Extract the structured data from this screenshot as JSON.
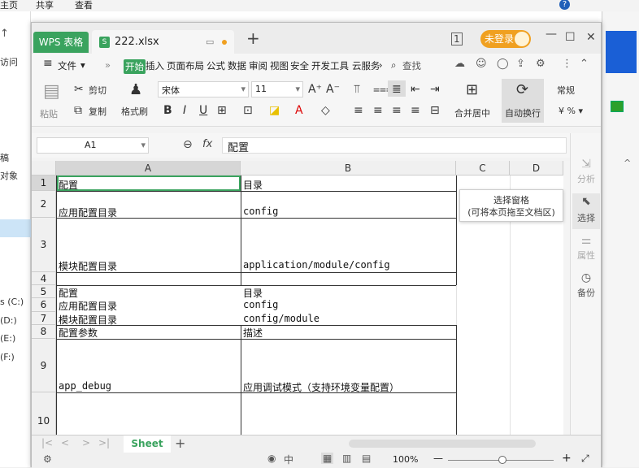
{
  "explorer": {
    "menu": [
      "主页",
      "共享",
      "查看"
    ],
    "sidebar": [
      "访问",
      "",
      "",
      "",
      "稿",
      "对象",
      "",
      "",
      "",
      "",
      "s (C:)",
      "(D:)",
      "(E:)",
      "(F:)"
    ]
  },
  "window": {
    "app_tab": "WPS 表格",
    "file_tab": "222.xlsx",
    "login": "未登录"
  },
  "menu": {
    "file": "文件",
    "tabs": [
      "开始",
      "插入",
      "页面布局",
      "公式",
      "数据",
      "审阅",
      "视图",
      "安全",
      "开发工具",
      "云服务"
    ],
    "search": "查找"
  },
  "ribbon": {
    "paste": "粘贴",
    "cut": "剪切",
    "copy": "复制",
    "format_painter": "格式刷",
    "font": "宋体",
    "size": "11",
    "merge": "合并居中",
    "wrap": "自动换行",
    "numfmt": "常规",
    "percent": "¥ % ▾"
  },
  "formula": {
    "cellref": "A1",
    "fx": "fx",
    "value": "配置"
  },
  "grid": {
    "cols": [
      "A",
      "B",
      "C",
      "D"
    ],
    "rows": [
      {
        "n": "1",
        "a": "配置",
        "b": "目录"
      },
      {
        "n": "2",
        "a": "应用配置目录",
        "b": "config"
      },
      {
        "n": "3",
        "a": "模块配置目录",
        "b": "application/module/config"
      },
      {
        "n": "4",
        "a": "",
        "b": ""
      },
      {
        "n": "5",
        "a": "配置",
        "b": "目录"
      },
      {
        "n": "6",
        "a": "应用配置目录",
        "b": "config"
      },
      {
        "n": "7",
        "a": "模块配置目录",
        "b": "config/module"
      },
      {
        "n": "8",
        "a": "配置参数",
        "b": "描述"
      },
      {
        "n": "9",
        "a": "app_debug",
        "b": "应用调试模式（支持环境变量配置）"
      },
      {
        "n": "10",
        "a": "",
        "b": ""
      }
    ]
  },
  "side": {
    "analyze": "分析",
    "select": "选择",
    "properties": "属性",
    "backup": "备份"
  },
  "tooltip": {
    "line1": "选择窗格",
    "line2": "(可将本页拖至文档区)"
  },
  "sheet": {
    "name": "Sheet",
    "add": "+"
  },
  "status": {
    "zoom": "100%"
  }
}
